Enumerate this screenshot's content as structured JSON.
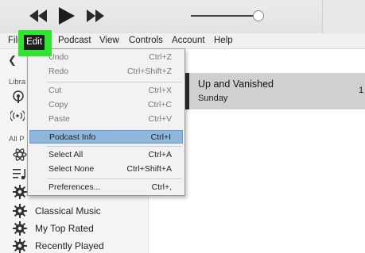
{
  "menubar": {
    "items": [
      "File",
      "Edit",
      "Podcast",
      "View",
      "Controls",
      "Account",
      "Help"
    ]
  },
  "edit_menu": {
    "items": [
      {
        "label": "Undo",
        "shortcut": "Ctrl+Z"
      },
      {
        "label": "Redo",
        "shortcut": "Ctrl+Shift+Z"
      },
      {
        "label": "Cut",
        "shortcut": "Ctrl+X"
      },
      {
        "label": "Copy",
        "shortcut": "Ctrl+C"
      },
      {
        "label": "Paste",
        "shortcut": "Ctrl+V"
      },
      {
        "label": "Podcast Info",
        "shortcut": "Ctrl+I"
      },
      {
        "label": "Select All",
        "shortcut": "Ctrl+A"
      },
      {
        "label": "Select None",
        "shortcut": "Ctrl+Shift+A"
      },
      {
        "label": "Preferences...",
        "shortcut": "Ctrl+,"
      }
    ],
    "highlight_color": "#8fb6dc"
  },
  "sidebar": {
    "section_library": "Libra",
    "section_playlists": "All P",
    "playlists": [
      "Classical Music",
      "My Top Rated",
      "Recently Played"
    ]
  },
  "episode": {
    "title": "Up and Vanished",
    "subtitle": "Sunday",
    "number": "1"
  },
  "volume": 0.88,
  "accent": "#2ee62e"
}
